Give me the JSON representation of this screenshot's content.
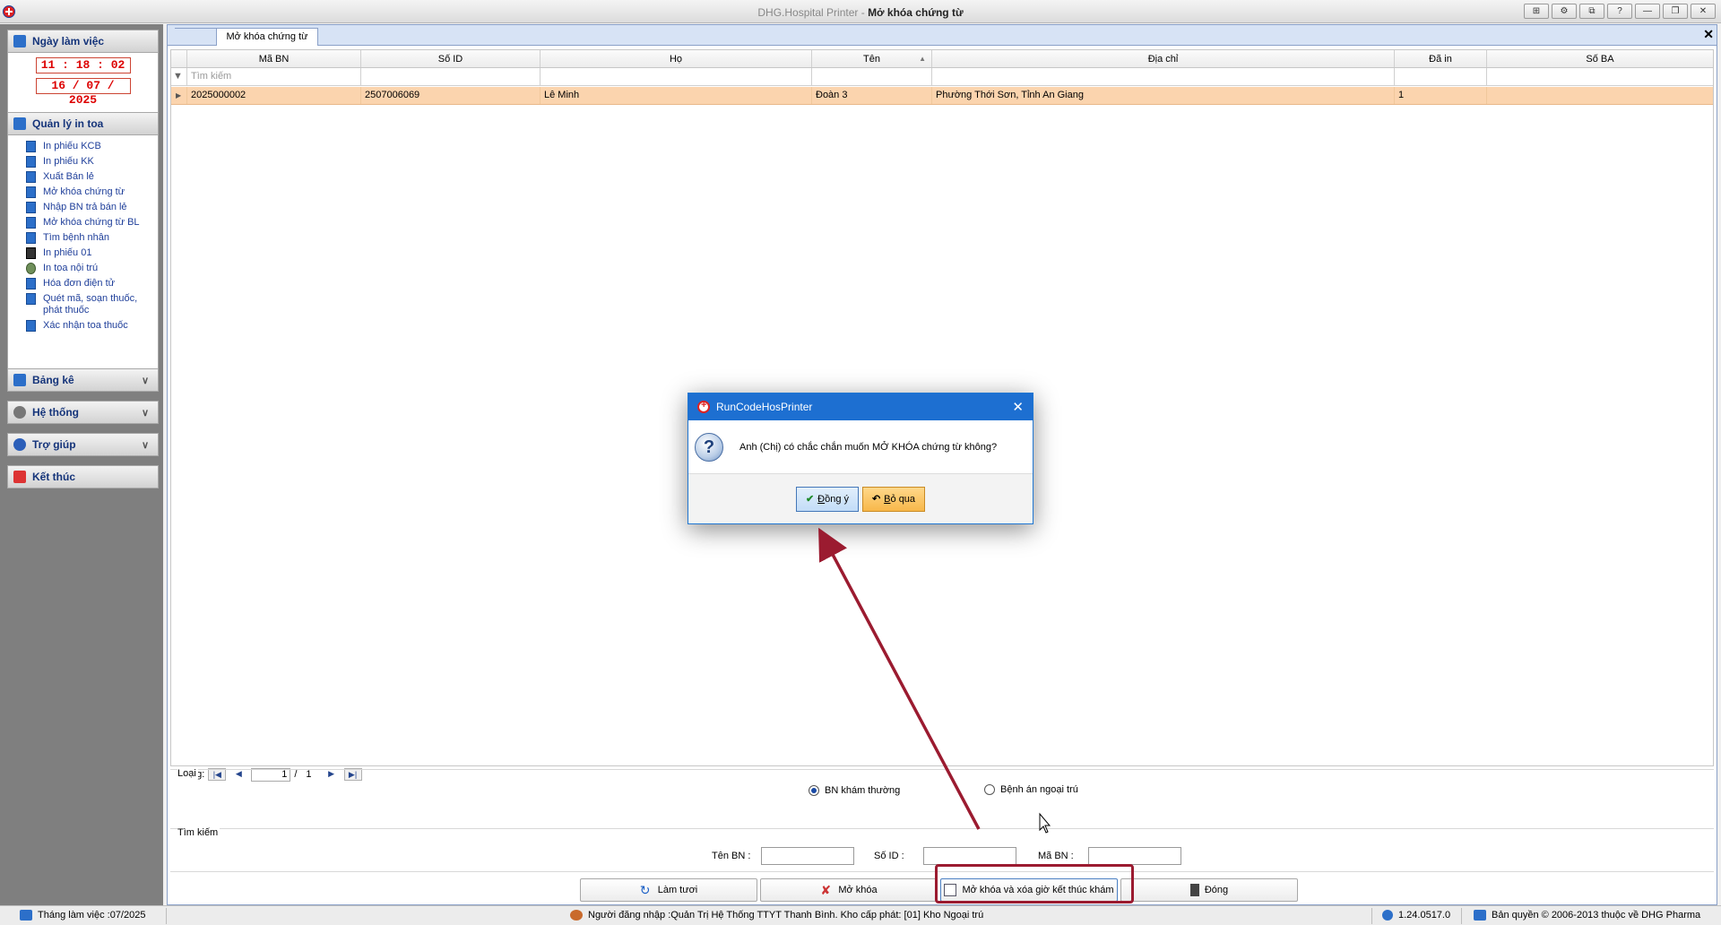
{
  "window": {
    "app_name": "DHG.Hospital Printer - ",
    "form_name": "Mở khóa chứng từ",
    "buttons": [
      "⊞",
      "⚙",
      "⧉",
      "?",
      "—",
      "❐",
      "✕"
    ]
  },
  "sidebar": {
    "workday": {
      "title": "Ngày làm việc",
      "time": "11 : 18 : 02",
      "date": "16 / 07 / 2025"
    },
    "manage": {
      "title": "Quản lý in toa",
      "items": [
        {
          "label": "In phiếu KCB"
        },
        {
          "label": "In phiếu KK"
        },
        {
          "label": "Xuất Bán lẻ"
        },
        {
          "label": "Mở khóa chứng từ"
        },
        {
          "label": "Nhập BN trả bán lẻ"
        },
        {
          "label": "Mở khóa chứng từ BL"
        },
        {
          "label": "Tìm bệnh nhân"
        },
        {
          "label": "In phiếu 01"
        },
        {
          "label": "In toa nội trú"
        },
        {
          "label": "Hóa đơn điện tử"
        },
        {
          "label": "Quét mã, soạn thuốc, phát thuốc"
        },
        {
          "label": "Xác nhận toa thuốc"
        }
      ]
    },
    "bangke": "Bảng kê",
    "hethong": "Hệ thống",
    "trogiup": "Trợ giúp",
    "ketthuc": "Kết thúc"
  },
  "tab": {
    "label": "Mở khóa chứng từ",
    "close": "✕"
  },
  "grid": {
    "columns": [
      "Mã BN",
      "Số ID",
      "Họ",
      "Tên",
      "Địa chỉ",
      "Đã in",
      "Số BA"
    ],
    "filter_placeholder": "Tìm kiếm",
    "rows": [
      {
        "ma_bn": "2025000002",
        "so_id": "2507006069",
        "ho": "Lê Minh",
        "ten": "Đoàn 3",
        "dia_chi": "Phường Thới Sơn, Tỉnh An Giang",
        "da_in": "1",
        "so_ba": ""
      }
    ]
  },
  "pager": {
    "label": "Dòng:",
    "current": "1",
    "sep": "/",
    "total": "1"
  },
  "loai": {
    "title": "Loại",
    "option1": "BN khám thường",
    "option2": "Bệnh án ngoại trú",
    "selected": "BN khám thường"
  },
  "search": {
    "title": "Tìm kiếm",
    "ten_bn": "Tên BN :",
    "so_id": "Số ID :",
    "ma_bn": "Mã BN :"
  },
  "buttons": {
    "refresh": "Làm tươi",
    "unlock": "Mở khóa",
    "unlock_clear": "Mở khóa và xóa giờ kết thúc khám",
    "close": "Đóng"
  },
  "status": {
    "month": "Tháng làm việc :07/2025",
    "user": "Người đăng nhập :Quản Trị Hệ Thống TTYT Thanh Bình. Kho cấp phát: [01] Kho Ngoại trú",
    "version": "1.24.0517.0",
    "copyright": "Bản quyền © 2006-2013 thuộc về DHG Pharma"
  },
  "dialog": {
    "title": "RunCodeHosPrinter",
    "message": "Anh (Chị) có chắc chắn muốn MỞ KHÓA chứng từ không?",
    "ok_prefix": "Đ",
    "ok_rest": "ồng ý",
    "cancel_prefix": "B",
    "cancel_rest": "ỏ qua"
  },
  "colors": {
    "accent": "#1d6fd1",
    "selected_row": "#fbd4ae",
    "highlight_box": "#9b1b30",
    "sidebar_bg": "#7f7f7f"
  }
}
